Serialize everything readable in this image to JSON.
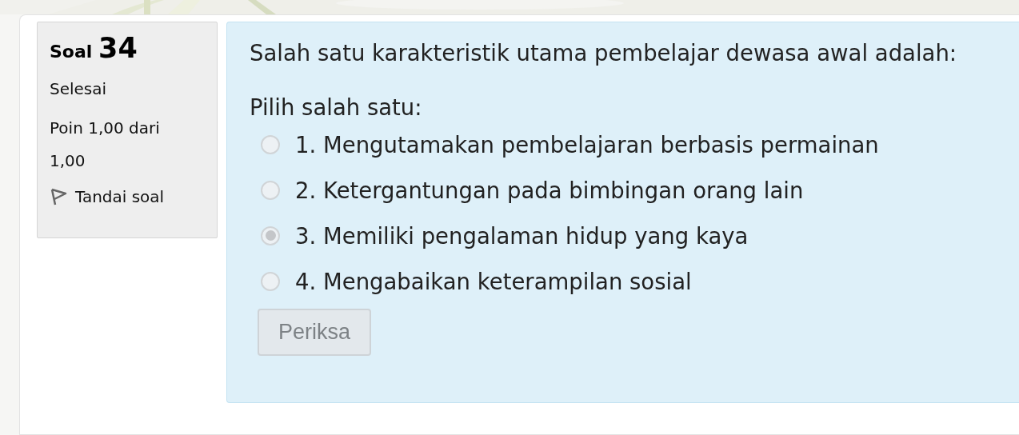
{
  "info": {
    "label": "Soal",
    "number": "34",
    "state": "Selesai",
    "grade": "Poin 1,00 dari 1,00",
    "flag": "Tandai soal"
  },
  "question": {
    "text": "Salah satu karakteristik utama pembelajar dewasa awal adalah:",
    "prompt": "Pilih salah satu:",
    "options": [
      {
        "label": "1. Mengutamakan pembelajaran berbasis permainan",
        "selected": false
      },
      {
        "label": "2. Ketergantungan pada bimbingan orang lain",
        "selected": false
      },
      {
        "label": "3. Memiliki pengalaman hidup yang kaya",
        "selected": true
      },
      {
        "label": "4. Mengabaikan keterampilan sosial",
        "selected": false
      }
    ],
    "button": {
      "label": "Periksa",
      "disabled": true
    }
  }
}
